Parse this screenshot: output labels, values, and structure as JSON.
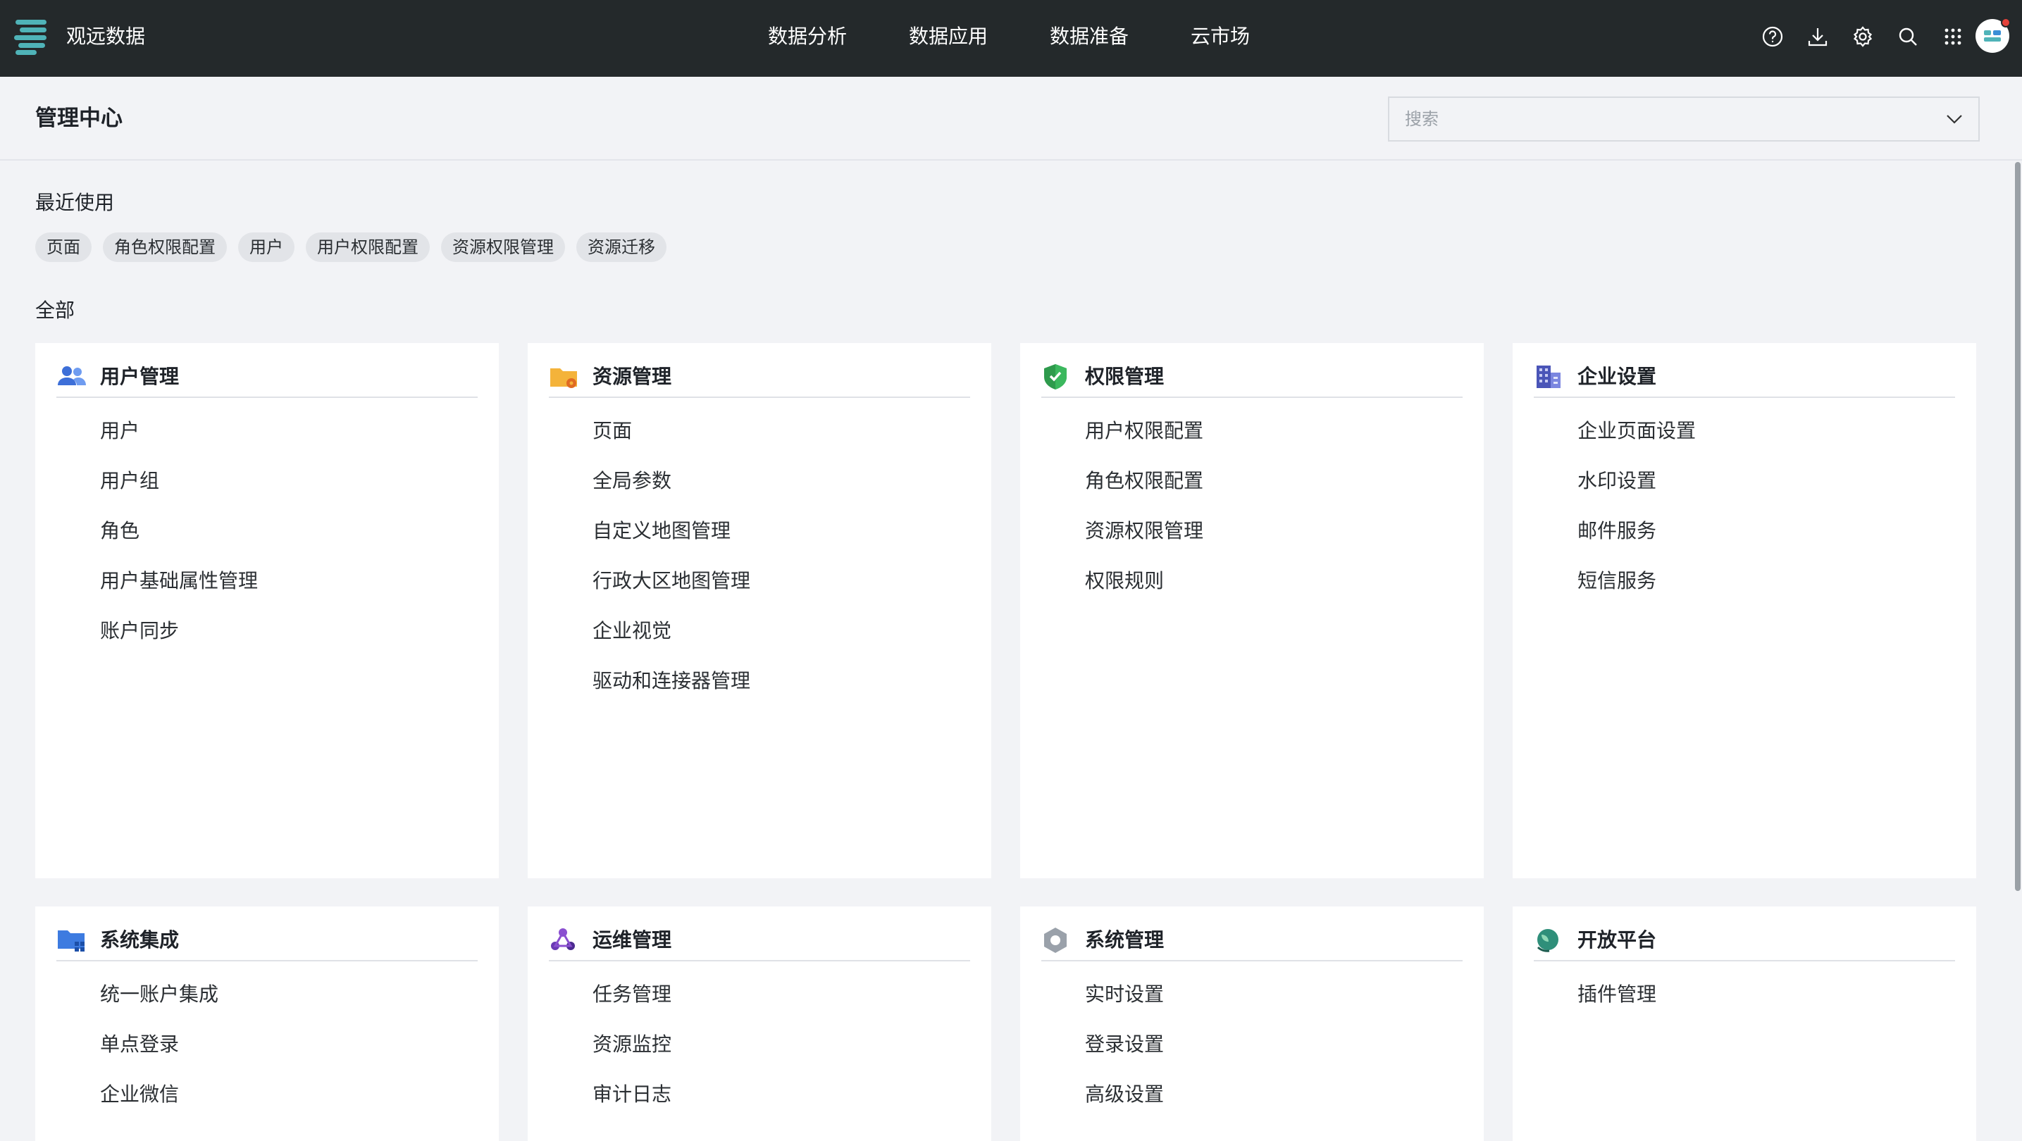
{
  "app": {
    "title": "观远数据"
  },
  "nav": {
    "items": [
      "数据分析",
      "数据应用",
      "数据准备",
      "云市场"
    ],
    "tools": [
      "help-circle-icon",
      "download-icon",
      "gear-icon",
      "search-icon",
      "grid-apps-icon"
    ]
  },
  "header": {
    "title": "管理中心",
    "search_placeholder": "搜索"
  },
  "recent": {
    "label": "最近使用",
    "tags": [
      "页面",
      "角色权限配置",
      "用户",
      "用户权限配置",
      "资源权限管理",
      "资源迁移"
    ]
  },
  "all": {
    "label": "全部"
  },
  "cards": [
    {
      "title": "用户管理",
      "icon": "users-icon",
      "items": [
        "用户",
        "用户组",
        "角色",
        "用户基础属性管理",
        "账户同步"
      ]
    },
    {
      "title": "资源管理",
      "icon": "folder-gear-icon",
      "items": [
        "页面",
        "全局参数",
        "自定义地图管理",
        "行政大区地图管理",
        "企业视觉",
        "驱动和连接器管理"
      ]
    },
    {
      "title": "权限管理",
      "icon": "shield-icon",
      "items": [
        "用户权限配置",
        "角色权限配置",
        "资源权限管理",
        "权限规则"
      ]
    },
    {
      "title": "企业设置",
      "icon": "building-icon",
      "items": [
        "企业页面设置",
        "水印设置",
        "邮件服务",
        "短信服务"
      ]
    },
    {
      "title": "系统集成",
      "icon": "folder-apps-icon",
      "items": [
        "统一账户集成",
        "单点登录",
        "企业微信"
      ]
    },
    {
      "title": "运维管理",
      "icon": "ops-triangle-icon",
      "items": [
        "任务管理",
        "资源监控",
        "审计日志"
      ]
    },
    {
      "title": "系统管理",
      "icon": "hex-nut-icon",
      "items": [
        "实时设置",
        "登录设置",
        "高级设置"
      ]
    },
    {
      "title": "开放平台",
      "icon": "globe-leaf-icon",
      "items": [
        "插件管理"
      ]
    }
  ],
  "colors": {
    "topbar": "#24292b",
    "accent": "#4fb3b8",
    "page_bg": "#f2f3f6",
    "card_bg": "#ffffff"
  }
}
